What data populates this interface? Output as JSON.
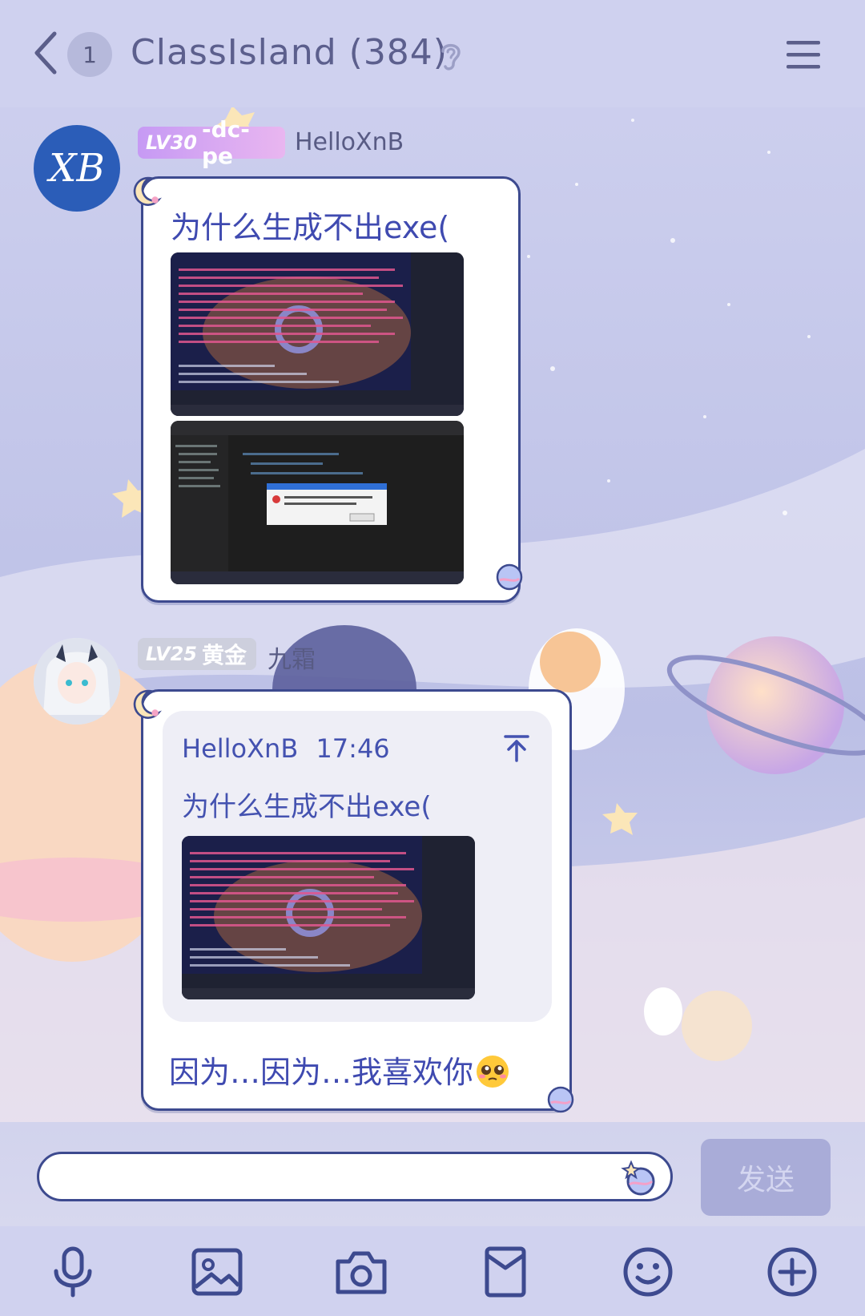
{
  "header": {
    "back_icon": "chevron-left-icon",
    "unread_count": "1",
    "title": "ClassIsland (384)",
    "ear_icon": "ear-icon",
    "menu_icon": "hamburger-menu-icon"
  },
  "messages": [
    {
      "avatar_text": "XB",
      "level": "LV30",
      "title_badge": "-dc-pe",
      "nickname": "HelloXnB",
      "text": "为什么生成不出exe("
    },
    {
      "level": "LV25",
      "title_badge": "黄金",
      "nickname": "九霜",
      "quote": {
        "author": "HelloXnB",
        "time": "17:46",
        "text": "为什么生成不出exe(",
        "jump_icon": "arrow-up-to-top-icon"
      },
      "text": "因为…因为…我喜欢你",
      "emoji": "pleading-face-emoji"
    }
  ],
  "composer": {
    "placeholder": "",
    "send_label": "发送",
    "sticker_icon": "planet-sticker-icon"
  },
  "toolbar": [
    "microphone-icon",
    "image-icon",
    "camera-icon",
    "red-packet-icon",
    "emoji-icon",
    "plus-icon"
  ],
  "colors": {
    "accent": "#3d4a8f",
    "bubble_text": "#3f4ab0",
    "lv30_badge": "#c79af5",
    "lv25_badge": "#cfd0dc"
  }
}
